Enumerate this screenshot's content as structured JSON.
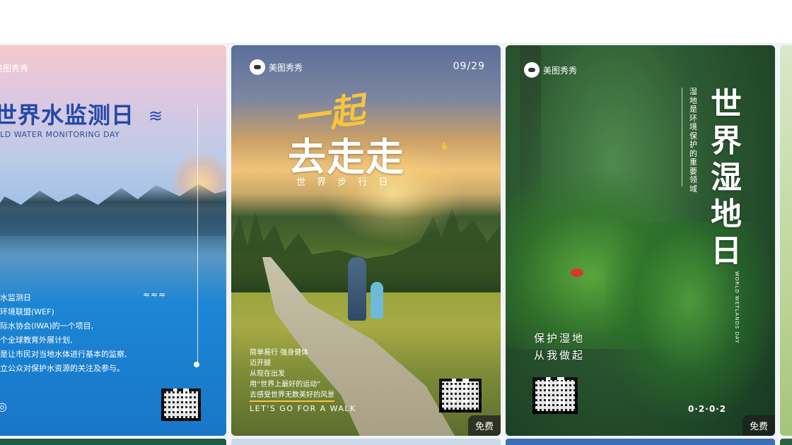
{
  "cards": [
    {
      "logo": "美图秀秀",
      "title": "世界水监测日",
      "subtitle": "RLD WATER MONITORING DAY",
      "body": [
        "水监测日",
        "环境联盟(WEF)",
        "际水协会(IWA)的一个项目,",
        "个全球教育外展计划,",
        "是让市民对当地水体进行基本的监察,",
        "立公众对保护水资源的关注及参与。"
      ]
    },
    {
      "logo": "美图秀秀",
      "date": "09/29",
      "title_line1": "一起",
      "title_line2": "去走走",
      "subtitle_spaced": "世 界 步 行 日",
      "body": [
        "简单易行 强身健体",
        "迈开腿",
        "从现在出发",
        "用“世界上最好的运动”",
        "去感受世界无数美好的风景"
      ],
      "tagline": "LET'S GO FOR  A WALK",
      "badge": "免费"
    },
    {
      "logo": "美图秀秀",
      "vertical_caption": "湿地是环境保护的重要领域",
      "title": "世界湿地日",
      "subtitle_vertical": "WORLD WETLANDS DAY",
      "slogan_line1": "保护湿地",
      "slogan_line2": "从我做起",
      "date_dots": "0·2·0·2",
      "badge": "免费"
    }
  ]
}
